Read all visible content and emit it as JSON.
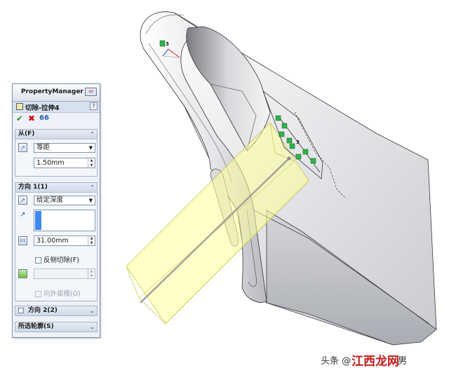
{
  "viewport": {
    "dim_labels": [
      "3",
      "3"
    ]
  },
  "property_manager": {
    "title": "PropertyManager",
    "feature_title": "切除-拉伸4",
    "help_label": "?",
    "icons": {
      "header": "pm-pin-icon",
      "feature": "cut-extrude-icon",
      "ok": "check-icon",
      "cancel": "x-icon",
      "preview": "glasses-icon"
    },
    "from_group": {
      "label": "从(F)",
      "condition_value": "等距",
      "offset_value": "1.50mm"
    },
    "direction1_group": {
      "label": "方向 1(1)",
      "end_condition_value": "给定深度",
      "depth_value": "31.00mm",
      "depth_icon_text": "D1",
      "flip_side_label": "反侧切除(F)",
      "flip_side_checked": false,
      "draft_label": "向外拔模(O)",
      "draft_checked": false
    },
    "direction2_group": {
      "label": "方向 2(2)",
      "checked": false
    },
    "contours_group": {
      "label": "所选轮廓(S)"
    }
  },
  "watermark": {
    "prefix": "头条 @",
    "brand": "江西龙网",
    "suffix": "男"
  },
  "colors": {
    "panel_bg": "#eef2f8",
    "accent_blue": "#3d8bf0",
    "preview_yellow": "#ffff9a",
    "relation_green": "#2fb24a",
    "ok_green": "#1f9a1f",
    "cancel_red": "#cc1111"
  }
}
